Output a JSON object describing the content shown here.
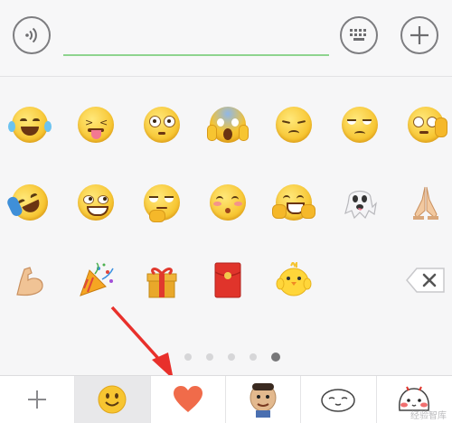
{
  "input_bar": {
    "input_value": "",
    "input_placeholder": ""
  },
  "emoji_panel": {
    "rows": [
      [
        "tears-of-joy",
        "squinting-tongue",
        "flushed",
        "screaming-in-fear",
        "pensive",
        "unamused",
        "facepalm"
      ],
      [
        "rolling-laughing",
        "sly-smile",
        "thinking",
        "kissing-blush",
        "peace-sign-face",
        "ghost",
        "folded-hands"
      ],
      [
        "flexed-biceps",
        "party-popper",
        "gift",
        "red-envelope",
        "chick",
        "",
        "backspace"
      ]
    ],
    "pager": {
      "pages": 5,
      "active": 4
    }
  },
  "tab_bar": {
    "tabs": [
      "add",
      "emoji",
      "heart",
      "meme-boy",
      "mochi-face",
      "red-cheek-face"
    ],
    "selected": 1
  },
  "colors": {
    "accent_green": "#8fd48f",
    "arrow_red": "#e8302b",
    "heart": "#f06b4a"
  },
  "watermark": "经验智库"
}
